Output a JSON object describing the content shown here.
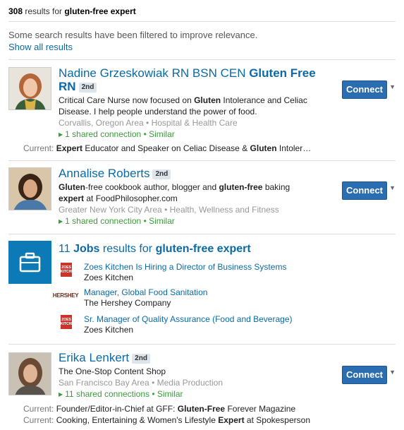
{
  "header": {
    "count": "308",
    "results_for": "results for",
    "query": "gluten-free expert"
  },
  "filter": {
    "note": "Some search results have been filtered to improve relevance.",
    "show_all": "Show all results"
  },
  "results": [
    {
      "name_plain": "Nadine Grzeskowiak RN BSN CEN",
      "name_bold_1": "Gluten Free",
      "name_bold_2": "RN",
      "degree": "2nd",
      "desc_line1": [
        "Critical Care Nurse now focused on ",
        "Gluten",
        " Intolerance and Celiac"
      ],
      "desc_line2": "Disease. I help people understand the power of food.",
      "meta": "Corvallis, Oregon Area • Hospital & Health Care",
      "shared": "1 shared connection • Similar",
      "current_label": "Current:",
      "current": [
        "Expert",
        " Educator and Speaker on Celiac Disease & ",
        "Gluten",
        " Intoler…"
      ],
      "connect": "Connect"
    },
    {
      "name_plain": "Annalise Roberts",
      "degree": "2nd",
      "desc_line1": [
        "Gluten",
        "-free cookbook author, blogger and ",
        "gluten",
        "-free",
        " baking"
      ],
      "desc_line2": [
        "expert",
        " at FoodPhilosopher.com"
      ],
      "meta": "Greater New York City Area • Health, Wellness and Fitness",
      "shared": "1 shared connection • Similar",
      "connect": "Connect"
    },
    {
      "name_plain": "Erika Lenkert",
      "degree": "2nd",
      "desc_line1": "The One-Stop Content Shop",
      "meta": "San Francisco Bay Area • Media Production",
      "shared": "11 shared connections • Similar",
      "current_label": "Current:",
      "current1": [
        "Founder/Editor-in-Chief at GFF: ",
        "Gluten-Free",
        " Forever Magazine"
      ],
      "current2": [
        "Cooking, Entertaining & Women's Lifestyle ",
        "Expert",
        " at Spokesperson"
      ],
      "connect": "Connect"
    }
  ],
  "jobs": {
    "count": "11",
    "jobs_word": "Jobs",
    "results_for": "results for",
    "query": "gluten-free expert",
    "icon": "briefcase-icon",
    "items": [
      {
        "title": "Zoes Kitchen Is Hiring a Director of Business Systems",
        "company": "Zoes Kitchen",
        "logo_text": "ZOES KITCHEN"
      },
      {
        "title": "Manager, Global Food Sanitation",
        "company": "The Hershey Company",
        "logo_text": "HERSHEY"
      },
      {
        "title": "Sr. Manager of Quality Assurance (Food and Beverage)",
        "company": "Zoes Kitchen",
        "logo_text": "ZOES KITCHEN"
      }
    ]
  },
  "colors": {
    "link": "#0b6aa5",
    "connect_button": "#2a6db1",
    "shared_green": "#3c9b3c",
    "jobs_icon_bg": "#0d7ab8"
  }
}
